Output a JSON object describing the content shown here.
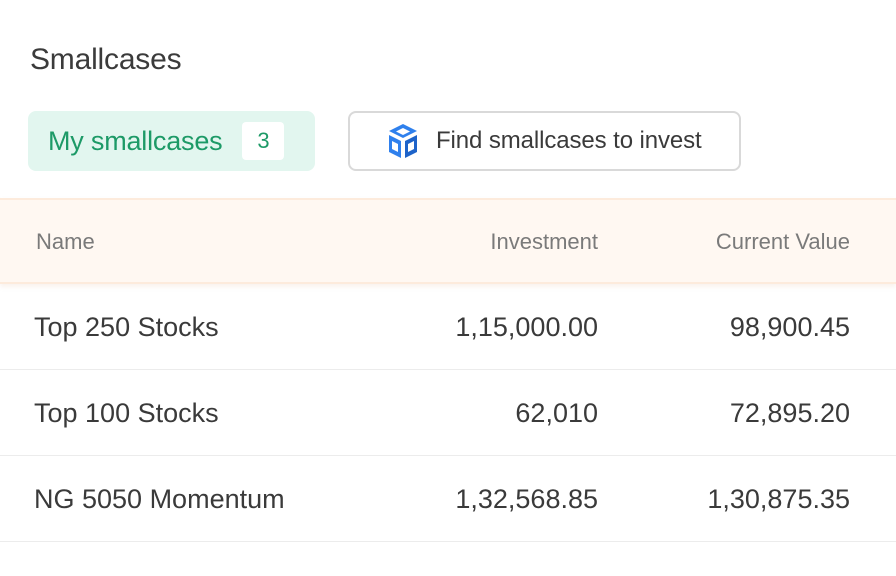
{
  "page": {
    "title": "Smallcases"
  },
  "tabs": {
    "my_smallcases_label": "My smallcases",
    "my_smallcases_count": "3",
    "find_label": "Find smallcases to invest",
    "find_icon": "cube-box-icon",
    "accent_color": "#1d9a67",
    "accent_bg": "#e2f6ef",
    "icon_color": "#2f80ed"
  },
  "table": {
    "headers": {
      "name": "Name",
      "investment": "Investment",
      "current_value": "Current Value"
    },
    "rows": [
      {
        "name": "Top 250 Stocks",
        "investment": "1,15,000.00",
        "current_value": "98,900.45"
      },
      {
        "name": "Top 100 Stocks",
        "investment": "62,010",
        "current_value": "72,895.20"
      },
      {
        "name": "NG 5050 Momentum",
        "investment": "1,32,568.85",
        "current_value": "1,30,875.35"
      }
    ]
  }
}
